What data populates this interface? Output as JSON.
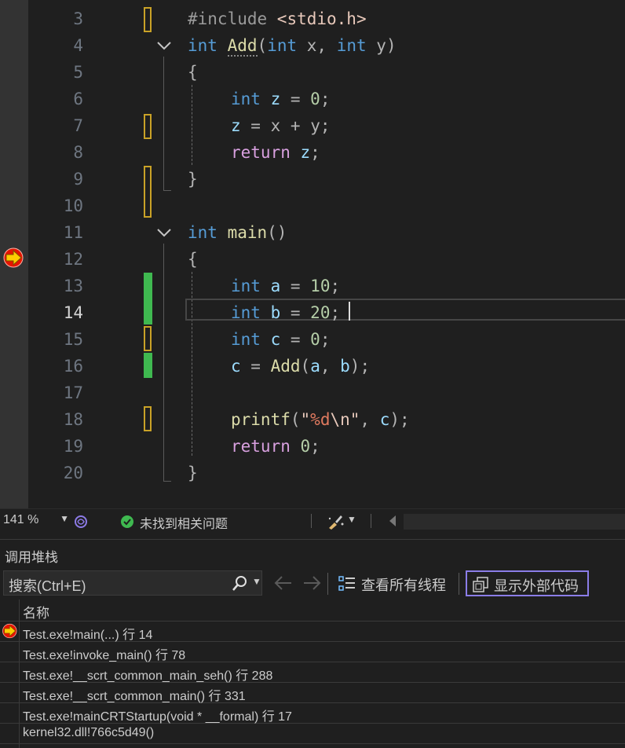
{
  "editor": {
    "line_numbers": [
      "3",
      "4",
      "5",
      "6",
      "7",
      "8",
      "9",
      "10",
      "11",
      "12",
      "13",
      "14",
      "15",
      "16",
      "17",
      "18",
      "19",
      "20"
    ],
    "current_line": "14",
    "lines": {
      "l3": {
        "pp": "#include ",
        "inc": "<stdio.h>"
      },
      "l4": {
        "t1": "int",
        "fn": "Add",
        "p1": "(",
        "t2": "int",
        "a1": " x",
        "c1": ", ",
        "t3": "int",
        "a2": " y",
        "p2": ")"
      },
      "l5": {
        "b": "{"
      },
      "l6": {
        "t": "int",
        "v": " z",
        "eq": " = ",
        "n": "0",
        "s": ";"
      },
      "l7": {
        "v1": "z",
        "eq": " = ",
        "v2": "x",
        "op": " + ",
        "v3": "y",
        "s": ";"
      },
      "l8": {
        "kw": "return",
        "v": " z",
        "s": ";"
      },
      "l9": {
        "b": "}"
      },
      "l11": {
        "t": "int",
        "fn": " main",
        "p": "()"
      },
      "l12": {
        "b": "{"
      },
      "l13": {
        "t": "int",
        "v": " a",
        "eq": " = ",
        "n": "10",
        "s": ";"
      },
      "l14": {
        "t": "int",
        "v": " b",
        "eq": " = ",
        "n": "20",
        "s": ";"
      },
      "l15": {
        "t": "int",
        "v": " c",
        "eq": " = ",
        "n": "0",
        "s": ";"
      },
      "l16": {
        "v": "c",
        "eq": " = ",
        "fn": "Add",
        "p1": "(",
        "a1": "a",
        "c": ", ",
        "a2": "b",
        "p2": ")",
        "s": ";"
      },
      "l18": {
        "fn": "printf",
        "p1": "(",
        "q1": "\"",
        "fmt": "%d",
        "esc": "\\n",
        "q2": "\"",
        "c": ", ",
        "v": "c",
        "p2": ")",
        "s": ";"
      },
      "l19": {
        "kw": "return",
        "sp": " ",
        "n": "0",
        "s": ";"
      },
      "l20": {
        "b": "}"
      }
    }
  },
  "statusbar": {
    "zoom": "141 %",
    "issues_text": "未找到相关问题"
  },
  "callstack": {
    "title": "调用堆栈",
    "search_placeholder": "搜索(Ctrl+E)",
    "view_all_threads": "查看所有线程",
    "show_external_code": "显示外部代码",
    "column_name": "名称",
    "rows": [
      "Test.exe!main(...) 行 14",
      "Test.exe!invoke_main() 行 78",
      "Test.exe!__scrt_common_main_seh() 行 288",
      "Test.exe!__scrt_common_main() 行 331",
      "Test.exe!mainCRTStartup(void * __formal) 行 17",
      "kernel32.dll!766c5d49()"
    ]
  },
  "colors": {
    "background": "#1f1f1f",
    "keyword": "#569cd6",
    "control_keyword": "#d8a0df",
    "function": "#dcdcaa",
    "identifier": "#9cdcfe",
    "number": "#b5cea8",
    "change_saved": "#3fb950",
    "change_unsaved": "#c9a227",
    "focus_border": "#8b7de8"
  }
}
